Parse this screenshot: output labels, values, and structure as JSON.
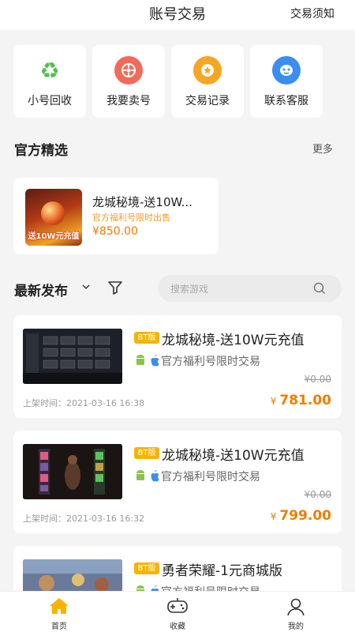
{
  "header": {
    "title": "账号交易",
    "notice_label": "交易须知"
  },
  "quick_actions": [
    {
      "label": "小号回收",
      "icon": "recycle-icon"
    },
    {
      "label": "我要卖号",
      "icon": "sell-icon"
    },
    {
      "label": "交易记录",
      "icon": "record-icon"
    },
    {
      "label": "联系客服",
      "icon": "customer-service-icon"
    }
  ],
  "featured_section": {
    "title": "官方精选",
    "more_label": "更多",
    "item": {
      "name": "龙城秘境-送10W...",
      "subtitle": "官方福利号限时出售",
      "price": "¥850.00",
      "thumb_banner": "送10W元充值"
    }
  },
  "filter": {
    "sort_label": "最新发布",
    "search_placeholder": "搜索游戏"
  },
  "listings": [
    {
      "badge": "BT版",
      "name": "龙城秘境-送10W元充值",
      "desc": "官方福利号限时交易",
      "original_price": "¥0.00",
      "time": "上架时间：2021-03-16 16:38",
      "yen": "¥",
      "price": "781.00"
    },
    {
      "badge": "BT版",
      "name": "龙城秘境-送10W元充值",
      "desc": "官方福利号限时交易",
      "original_price": "¥0.00",
      "time": "上架时间：2021-03-16 16:32",
      "yen": "¥",
      "price": "799.00"
    },
    {
      "badge": "BT版",
      "name": "勇者荣耀-1元商城版",
      "desc": "官方福利号限时交易",
      "original_price": "",
      "time": "",
      "yen": "",
      "price": ""
    }
  ],
  "tabbar": [
    {
      "label": "首页",
      "icon": "home-icon",
      "active": true
    },
    {
      "label": "收藏",
      "icon": "gamepad-icon",
      "active": false
    },
    {
      "label": "我的",
      "icon": "user-icon",
      "active": false
    }
  ],
  "colors": {
    "accent": "#f07d00",
    "badge": "#f5b400",
    "home_active": "#f5b400"
  }
}
